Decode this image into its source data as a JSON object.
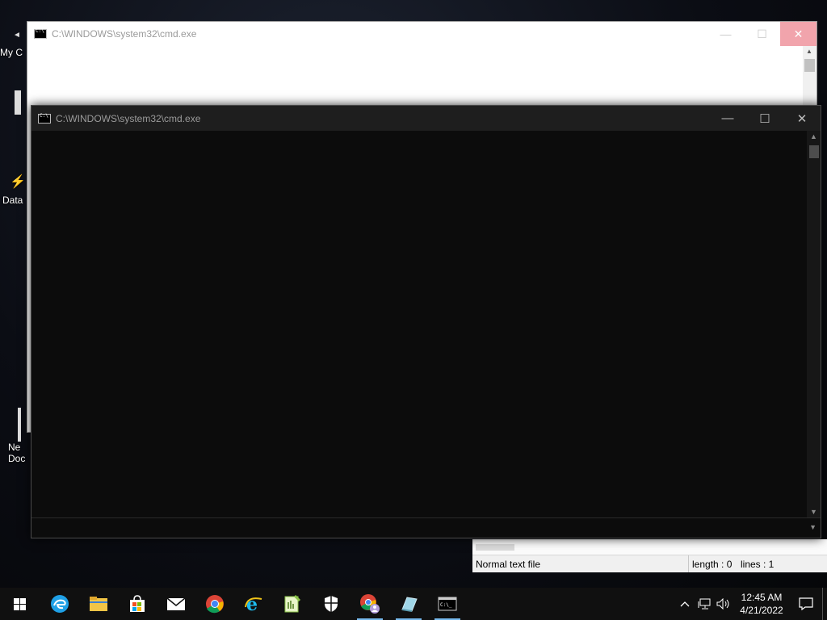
{
  "desktop": {
    "icons": [
      {
        "label": "My C"
      },
      {
        "label": "Data"
      },
      {
        "label": "Ne Doc"
      }
    ]
  },
  "back_window": {
    "title": "C:\\WINDOWS\\system32\\cmd.exe",
    "minimize": "—",
    "maximize": "☐",
    "close": "✕"
  },
  "front_window": {
    "title": "C:\\WINDOWS\\system32\\cmd.exe",
    "minimize": "—",
    "maximize": "☐",
    "close": "✕"
  },
  "statusbar": {
    "type": "Normal text file",
    "length": "length : 0",
    "lines": "lines : 1"
  },
  "taskbar": {
    "apps": [
      {
        "name": "start-button",
        "icon": "windows-logo-icon"
      },
      {
        "name": "edge",
        "icon": "edge-icon",
        "color": "#1fa0e6"
      },
      {
        "name": "file-explorer",
        "icon": "folder-icon",
        "color": "#f2c546"
      },
      {
        "name": "store",
        "icon": "store-icon",
        "color": "#ffffff"
      },
      {
        "name": "mail",
        "icon": "mail-icon",
        "color": "#ffffff"
      },
      {
        "name": "chrome",
        "icon": "chrome-icon",
        "color": "#db4437"
      },
      {
        "name": "internet-explorer",
        "icon": "ie-icon",
        "color": "#1ebbee"
      },
      {
        "name": "notepad-plus-plus",
        "icon": "notepadpp-icon",
        "color": "#8bc34a"
      },
      {
        "name": "security",
        "icon": "shield-icon",
        "color": "#ffffff"
      },
      {
        "name": "chrome-profile",
        "icon": "chrome-profile-icon",
        "color": "#db4437"
      },
      {
        "name": "app",
        "icon": "cube-icon",
        "color": "#9fd6e8"
      },
      {
        "name": "cmd",
        "icon": "cmd-icon",
        "color": "#ffffff"
      }
    ],
    "clock_time": "12:45 AM",
    "clock_date": "4/21/2022"
  }
}
